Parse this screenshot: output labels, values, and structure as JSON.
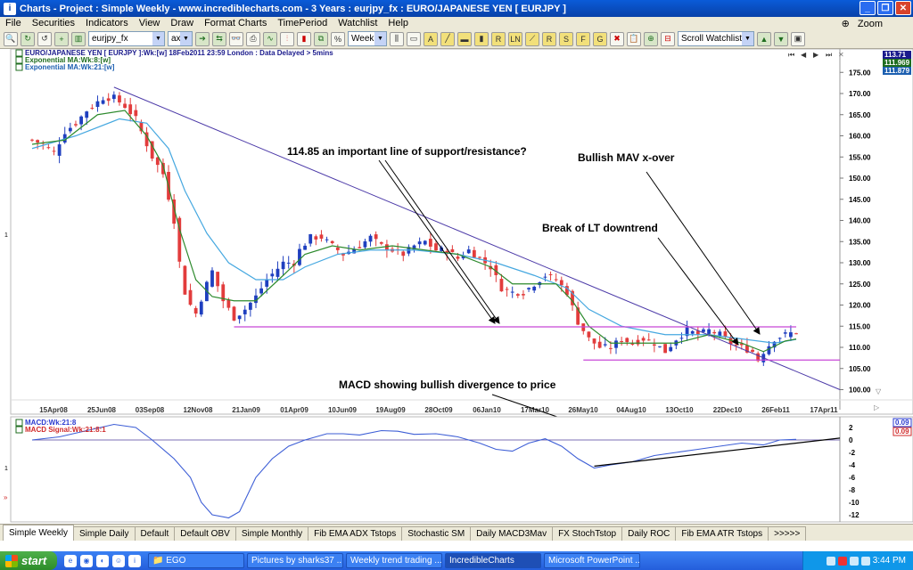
{
  "window": {
    "title": "Charts - Project : Simple Weekly - www.incrediblecharts.com - 3 Years : eurjpy_fx : EURO/JAPANESE YEN  [ EURJPY ]"
  },
  "menu": [
    "File",
    "Securities",
    "Indicators",
    "View",
    "Draw",
    "Format Charts",
    "TimePeriod",
    "Watchlist",
    "Help"
  ],
  "zoom_label": "Zoom",
  "toolbar": {
    "security_combo": "eurjpy_fx",
    "ax_combo": "ax",
    "period_combo": "Weekly",
    "watchlist_combo": "Scroll Watchlist",
    "tool_letters": [
      "A",
      "",
      "",
      "R",
      "LN",
      "",
      "R",
      "S",
      "F",
      "G",
      ""
    ]
  },
  "legend": {
    "line1": "EURO/JAPANESE YEN [ EURJPY ]:Wk:[w]  18Feb2011 23:59 London : Data Delayed > 5mins",
    "line2": "Exponential MA:Wk:8:[w]",
    "line3": "Exponential MA:Wk:21:[w]"
  },
  "price_badges": [
    {
      "label": "113.71",
      "color": "#1a1a8c"
    },
    {
      "label": "111.969",
      "color": "#1f6d1f"
    },
    {
      "label": "111.879",
      "color": "#1c5fb0"
    }
  ],
  "macd_legend": {
    "line1": "MACD:Wk:21:8",
    "line2": "MACD Signal:Wk:21:8:1"
  },
  "macd_badges": [
    {
      "label": "0.09",
      "color": "#2a3bd0"
    },
    {
      "label": "0.09",
      "color": "#d02a2a"
    }
  ],
  "annotations": {
    "support": "114.85 an important line of support/resistance?",
    "mav": "Bullish MAV x-over",
    "lt": "Break of LT downtrend",
    "macd": "MACD showing bullish divergence to price"
  },
  "pane_markers": {
    "price": "1",
    "macd": "1"
  },
  "colors": {
    "up": "#1f3fbf",
    "down": "#e23c3c",
    "ema8": "#2d8a2d",
    "ema21": "#46a8e0",
    "trend": "#4c3aa8",
    "support": "#c848d8",
    "macd": "#3d5ed6"
  },
  "chart_data": {
    "type": "candlestick",
    "x": [
      "15Apr08",
      "25Jun08",
      "03Sep08",
      "12Nov08",
      "21Jan09",
      "01Apr09",
      "10Jun09",
      "19Aug09",
      "28Oct09",
      "06Jan10",
      "17Mar10",
      "26May10",
      "04Aug10",
      "13Oct10",
      "22Dec10",
      "26Feb11",
      "17Apr11"
    ],
    "y_ticks": [
      100,
      105,
      110,
      115,
      120,
      125,
      130,
      135,
      140,
      145,
      150,
      155,
      160,
      165,
      170,
      175
    ],
    "ylim": [
      98,
      178
    ],
    "close_path": [
      [
        0,
        159
      ],
      [
        2,
        158
      ],
      [
        4,
        156
      ],
      [
        6,
        161
      ],
      [
        8,
        163
      ],
      [
        10,
        166
      ],
      [
        13,
        169
      ],
      [
        15,
        169
      ],
      [
        17,
        167
      ],
      [
        19,
        164
      ],
      [
        21,
        158
      ],
      [
        22,
        155
      ],
      [
        24,
        151
      ],
      [
        26,
        140
      ],
      [
        27,
        130
      ],
      [
        28,
        123
      ],
      [
        29,
        120
      ],
      [
        30,
        118
      ],
      [
        32,
        125
      ],
      [
        33,
        128
      ],
      [
        35,
        121
      ],
      [
        37,
        117
      ],
      [
        39,
        119
      ],
      [
        41,
        122
      ],
      [
        43,
        126
      ],
      [
        46,
        130
      ],
      [
        48,
        130
      ],
      [
        49,
        133
      ],
      [
        51,
        136
      ],
      [
        53,
        136
      ],
      [
        55,
        134
      ],
      [
        57,
        132
      ],
      [
        60,
        134
      ],
      [
        62,
        136
      ],
      [
        64,
        134
      ],
      [
        66,
        133
      ],
      [
        68,
        132
      ],
      [
        70,
        134
      ],
      [
        72,
        135
      ],
      [
        74,
        133
      ],
      [
        76,
        133
      ],
      [
        78,
        131
      ],
      [
        80,
        133
      ],
      [
        82,
        131
      ],
      [
        84,
        129
      ],
      [
        86,
        124
      ],
      [
        88,
        123
      ],
      [
        90,
        123
      ],
      [
        92,
        125
      ],
      [
        94,
        127
      ],
      [
        96,
        126
      ],
      [
        98,
        123
      ],
      [
        100,
        116
      ],
      [
        102,
        112
      ],
      [
        104,
        110
      ],
      [
        106,
        110
      ],
      [
        108,
        112
      ],
      [
        110,
        111
      ],
      [
        112,
        112
      ],
      [
        114,
        111
      ],
      [
        116,
        109
      ],
      [
        118,
        112
      ],
      [
        120,
        114
      ],
      [
        122,
        113
      ],
      [
        124,
        114
      ],
      [
        126,
        113
      ],
      [
        128,
        111
      ],
      [
        130,
        110
      ],
      [
        132,
        109
      ],
      [
        133,
        107
      ],
      [
        134,
        109
      ],
      [
        136,
        112
      ],
      [
        138,
        113
      ],
      [
        140,
        113.7
      ]
    ],
    "ema8_path": [
      [
        0,
        158
      ],
      [
        6,
        159
      ],
      [
        12,
        165
      ],
      [
        17,
        166
      ],
      [
        21,
        160
      ],
      [
        24,
        153
      ],
      [
        27,
        138
      ],
      [
        30,
        126
      ],
      [
        33,
        122
      ],
      [
        37,
        121
      ],
      [
        41,
        121
      ],
      [
        46,
        127
      ],
      [
        50,
        132
      ],
      [
        55,
        134
      ],
      [
        60,
        133
      ],
      [
        66,
        134
      ],
      [
        72,
        133
      ],
      [
        78,
        132
      ],
      [
        84,
        129
      ],
      [
        88,
        125
      ],
      [
        92,
        125
      ],
      [
        96,
        125
      ],
      [
        99,
        121
      ],
      [
        102,
        115
      ],
      [
        106,
        111
      ],
      [
        112,
        111
      ],
      [
        118,
        111
      ],
      [
        124,
        113
      ],
      [
        130,
        111
      ],
      [
        134,
        109
      ],
      [
        138,
        111.5
      ],
      [
        140,
        111.97
      ]
    ],
    "ema21_path": [
      [
        0,
        157
      ],
      [
        8,
        160
      ],
      [
        16,
        164
      ],
      [
        21,
        163
      ],
      [
        25,
        157
      ],
      [
        28,
        147
      ],
      [
        32,
        137
      ],
      [
        36,
        130
      ],
      [
        41,
        126
      ],
      [
        46,
        126
      ],
      [
        50,
        129
      ],
      [
        56,
        132
      ],
      [
        62,
        133
      ],
      [
        70,
        133
      ],
      [
        78,
        132
      ],
      [
        85,
        130
      ],
      [
        92,
        127
      ],
      [
        98,
        124
      ],
      [
        102,
        119
      ],
      [
        108,
        115
      ],
      [
        116,
        113
      ],
      [
        124,
        113
      ],
      [
        130,
        112
      ],
      [
        136,
        111
      ],
      [
        140,
        111.88
      ]
    ],
    "trendline": [
      [
        15,
        171.5
      ],
      [
        148,
        100
      ]
    ],
    "support_line": {
      "value": 114.85,
      "from": 37,
      "to": 140
    },
    "lower_support_line": {
      "value": 107,
      "from": 101,
      "to": 148
    },
    "macd": {
      "y_ticks": [
        2,
        0,
        -2,
        -4,
        -6,
        -8,
        -10,
        -12
      ],
      "ylim": [
        -13,
        3
      ],
      "series": [
        [
          0,
          0
        ],
        [
          5,
          0.5
        ],
        [
          10,
          1.5
        ],
        [
          15,
          2.5
        ],
        [
          19,
          2
        ],
        [
          22,
          0
        ],
        [
          26,
          -3
        ],
        [
          29,
          -6
        ],
        [
          31,
          -10
        ],
        [
          33,
          -12
        ],
        [
          36,
          -12.5
        ],
        [
          38,
          -11.5
        ],
        [
          41,
          -6
        ],
        [
          44,
          -3
        ],
        [
          47,
          -1
        ],
        [
          50,
          0
        ],
        [
          54,
          1
        ],
        [
          57,
          1
        ],
        [
          60,
          0.8
        ],
        [
          64,
          1.5
        ],
        [
          67,
          1.4
        ],
        [
          70,
          0.9
        ],
        [
          74,
          1
        ],
        [
          78,
          0.5
        ],
        [
          82,
          -0.5
        ],
        [
          85,
          -1.5
        ],
        [
          88,
          -1.8
        ],
        [
          91,
          -0.5
        ],
        [
          94,
          0.2
        ],
        [
          97,
          -1
        ],
        [
          100,
          -3
        ],
        [
          103,
          -4.5
        ],
        [
          106,
          -4
        ],
        [
          110,
          -3.5
        ],
        [
          114,
          -2.5
        ],
        [
          118,
          -2
        ],
        [
          122,
          -1.5
        ],
        [
          126,
          -1
        ],
        [
          130,
          -0.5
        ],
        [
          134,
          -0.8
        ],
        [
          137,
          0
        ],
        [
          140,
          0.1
        ]
      ],
      "divergence_line": [
        [
          103,
          -4.2
        ],
        [
          148,
          0.3
        ]
      ]
    }
  }
}
